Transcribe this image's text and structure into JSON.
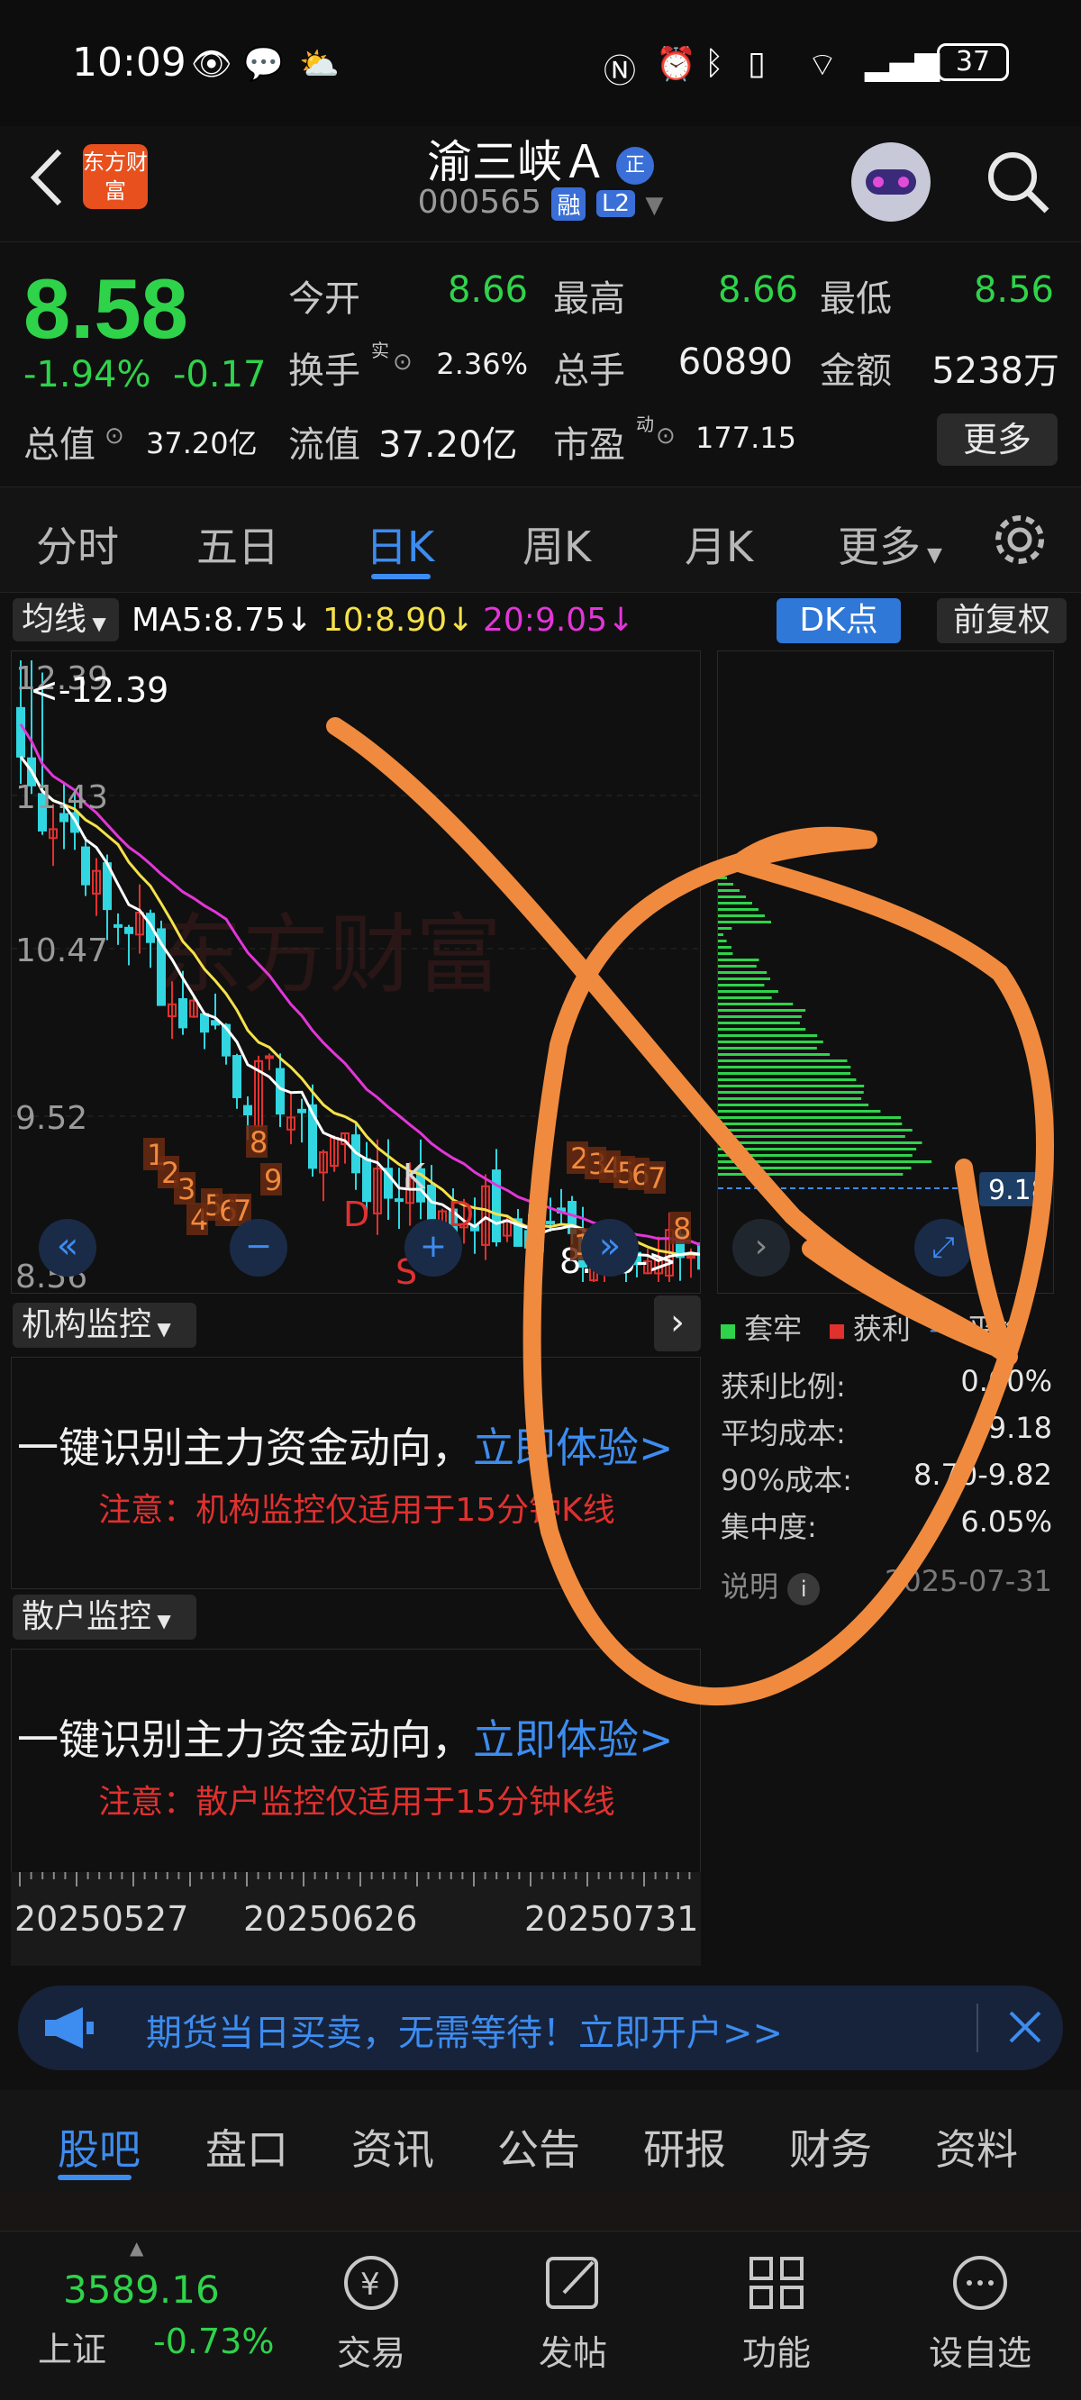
{
  "status_bar": {
    "time": "10:09",
    "battery": "37"
  },
  "header": {
    "logo_text": "东方财富",
    "stock_name": "渝三峡Ａ",
    "zheng_badge": "正",
    "code": "000565",
    "tag_rong": "融",
    "tag_l2": "L2"
  },
  "quote": {
    "price": "8.58",
    "change_pct": "-1.94%",
    "change_amt": "-0.17",
    "open_label": "今开",
    "open_value": "8.66",
    "high_label": "最高",
    "high_value": "8.66",
    "low_label": "最低",
    "low_value": "8.56",
    "turnover_label": "换手",
    "turnover_value": "2.36%",
    "turnover_sup": "实",
    "volume_label": "总手",
    "volume_value": "60890",
    "amount_label": "金额",
    "amount_value": "5238万",
    "total_mv_label": "总值",
    "total_mv_value": "37.20亿",
    "float_mv_label": "流值",
    "float_mv_value": "37.20亿",
    "pe_label": "市盈",
    "pe_value": "177.15",
    "pe_sup": "动",
    "more_button": "更多"
  },
  "chart_tabs": [
    "分时",
    "五日",
    "日K",
    "周K",
    "月K",
    "更多"
  ],
  "active_chart_tab": "日K",
  "ma_bar": {
    "selector": "均线",
    "ma5": "MA5:8.75↓",
    "ma10": "10:8.90↓",
    "ma20": "20:9.05↓",
    "dk_button": "DK点",
    "fq_button": "前复权"
  },
  "chart": {
    "watermark": "东方财富",
    "y_ticks": [
      "12.39",
      "11.43",
      "10.47",
      "9.52",
      "8.56"
    ],
    "max_marker": "<-12.39",
    "min_marker": "8.56->",
    "signal_d1": "D",
    "signal_d2": "D",
    "signal_s": "S",
    "signal_k": "K"
  },
  "chips": {
    "cost_marker": "9.18",
    "legend_trapped": "套牢",
    "legend_profit": "获利",
    "legend_avg": "平均",
    "stats": [
      {
        "label": "获利比例:",
        "value": "0.00%"
      },
      {
        "label": "平均成本:",
        "value": "9.18"
      },
      {
        "label": "90%成本:",
        "value": "8.70-9.82"
      },
      {
        "label": "集中度:",
        "value": "6.05%"
      }
    ],
    "explain_label": "说明",
    "date": "2025-07-31"
  },
  "institution_monitor": {
    "selector": "机构监控",
    "main_text": "一键识别主力资金动向，",
    "link": "立即体验>",
    "note": "注意：机构监控仅适用于15分钟K线"
  },
  "retail_monitor": {
    "selector": "散户监控",
    "main_text": "一键识别主力资金动向，",
    "link": "立即体验>",
    "note": "注意：散户监控仅适用于15分钟K线"
  },
  "date_axis": [
    "20250527",
    "20250626",
    "20250731"
  ],
  "banner": {
    "text": "期货当日买卖，无需等待！立即开户>>"
  },
  "sub_tabs": [
    "股吧",
    "盘口",
    "资讯",
    "公告",
    "研报",
    "财务",
    "资料"
  ],
  "active_sub_tab": "股吧",
  "bottom_nav": {
    "index_value": "3589.16",
    "index_name": "上证",
    "index_change": "-0.73%",
    "items": [
      "交易",
      "发帖",
      "功能",
      "设自选"
    ]
  },
  "colors": {
    "up": "#e0312f",
    "down": "#2fd34a",
    "accent": "#3d8cf0",
    "ma5": "#ffffff",
    "ma10": "#f5e14a",
    "ma20": "#e236d8",
    "candle_down": "#31d6e0",
    "candle_up": "#e0312f",
    "annotation": "#f08a3e"
  }
}
